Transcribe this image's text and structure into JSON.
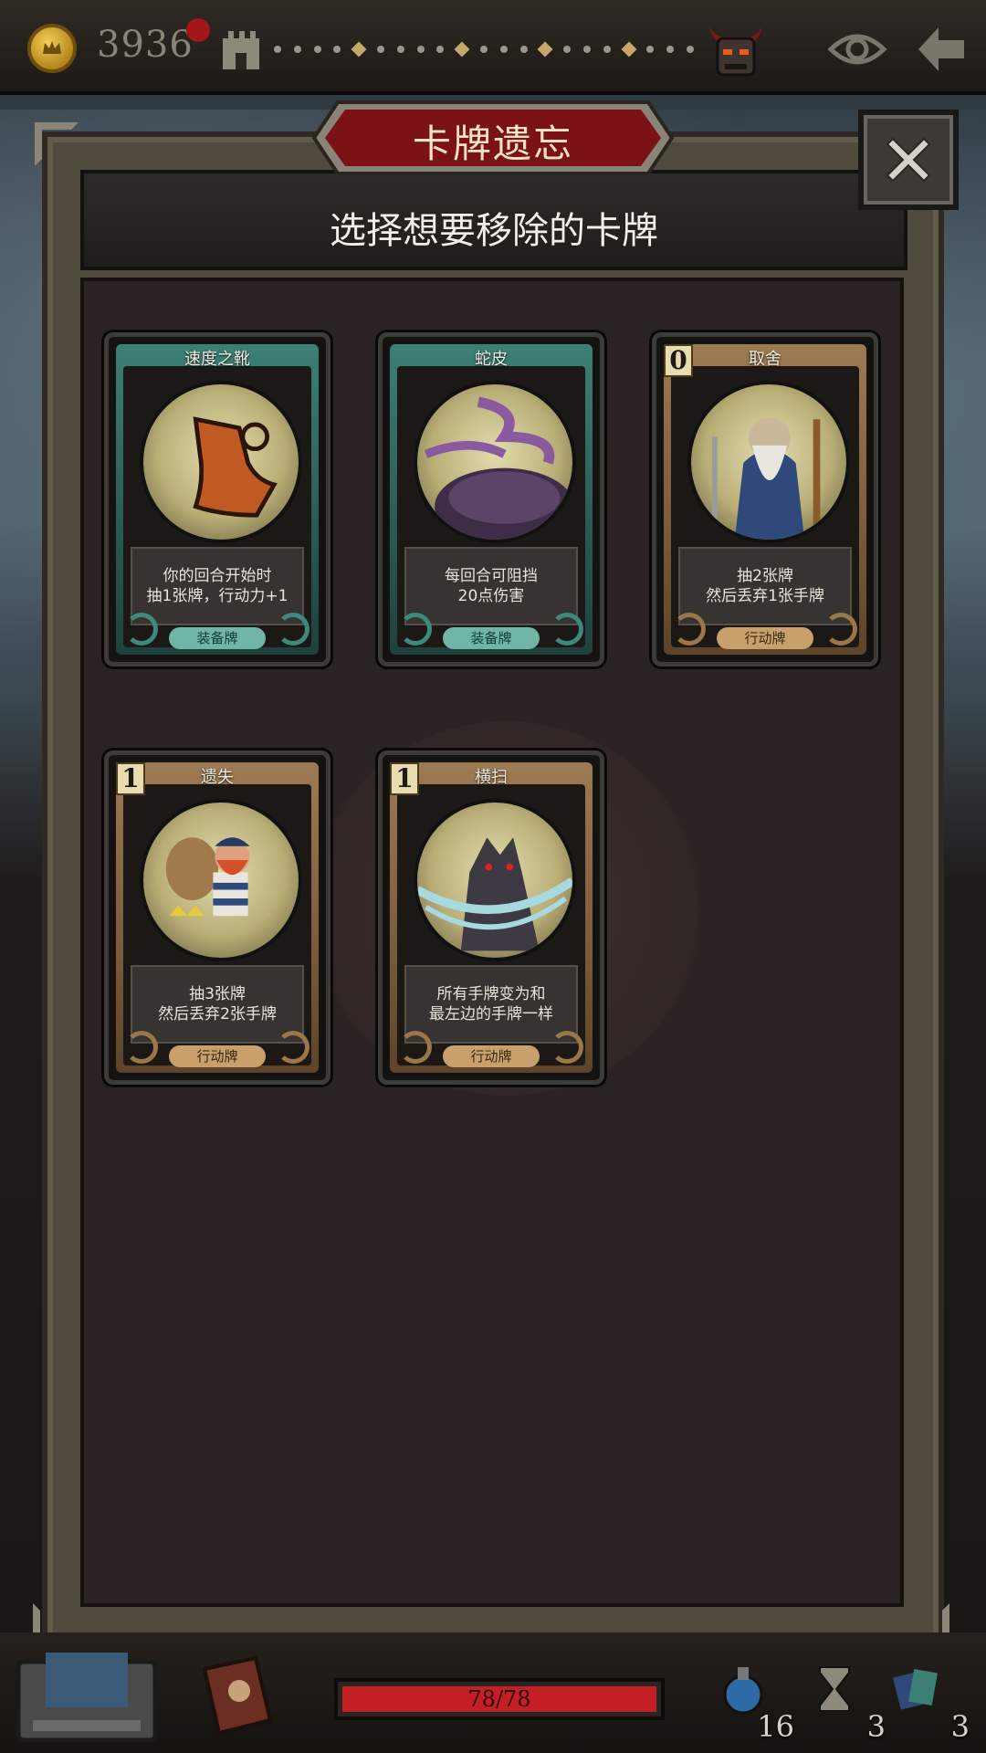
{
  "topbar": {
    "gold": "3936",
    "icons": [
      "coin-icon",
      "castle-tower-icon",
      "demon-boss-icon",
      "eye-icon",
      "back-arrow-icon"
    ],
    "path_nodes": [
      "dot",
      "dot",
      "dot",
      "dot",
      "diamond",
      "dot",
      "dot",
      "dot",
      "dot",
      "diamond",
      "dot",
      "dot",
      "dot",
      "diamond",
      "dot",
      "dot",
      "dot",
      "diamond",
      "dot",
      "dot",
      "dot"
    ]
  },
  "panel": {
    "title": "卡牌遗忘",
    "subtitle": "选择想要移除的卡牌",
    "close_icon": "close-x-icon"
  },
  "cards": [
    {
      "name": "速度之靴",
      "cost": "",
      "desc_line1": "你的回合开始时",
      "desc_line2": "抽1张牌，行动力+1",
      "type": "装备牌",
      "kind": "equip",
      "art": "boot-icon"
    },
    {
      "name": "蛇皮",
      "cost": "",
      "desc_line1": "每回合可阻挡",
      "desc_line2": "20点伤害",
      "type": "装备牌",
      "kind": "equip",
      "art": "snakeskin-icon"
    },
    {
      "name": "取舍",
      "cost": "0",
      "desc_line1": "抽2张牌",
      "desc_line2": "然后丢弃1张手牌",
      "type": "行动牌",
      "kind": "action",
      "art": "old-wizard-icon"
    },
    {
      "name": "遗失",
      "cost": "1",
      "desc_line1": "抽3张牌",
      "desc_line2": "然后丢弃2张手牌",
      "type": "行动牌",
      "kind": "action",
      "art": "pirate-thief-icon"
    },
    {
      "name": "横扫",
      "cost": "1",
      "desc_line1": "所有手牌变为和",
      "desc_line2": "最左边的手牌一样",
      "type": "行动牌",
      "kind": "action",
      "art": "werewolf-icon"
    }
  ],
  "bottombar": {
    "hp": "78/78",
    "hp_fraction": 1.0,
    "potions": "16",
    "hourglass": "3",
    "deck": "3",
    "icons": [
      "treasure-chest-icon",
      "journal-book-icon",
      "potion-icon",
      "hourglass-icon",
      "card-deck-icon"
    ]
  },
  "colors": {
    "accent_red": "#c41f24",
    "equip_frame": "#3c7f75",
    "action_frame": "#9d7a52",
    "title_plate": "#7a1216"
  }
}
